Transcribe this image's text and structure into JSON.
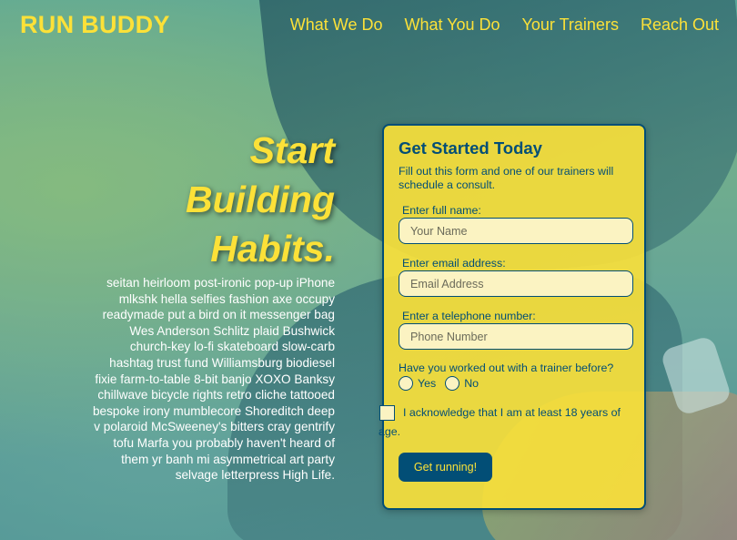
{
  "header": {
    "logo": "RUN BUDDY",
    "nav": [
      "What We Do",
      "What You Do",
      "Your Trainers",
      "Reach Out"
    ]
  },
  "intro": {
    "headline_1": "Start",
    "headline_2": "Building",
    "headline_3": "Habits.",
    "body": "seitan heirloom post-ironic pop-up iPhone mlkshk hella selfies fashion axe occupy readymade put a bird on it messenger bag Wes Anderson Schlitz plaid Bushwick church-key lo-fi skateboard slow-carb hashtag trust fund Williamsburg biodiesel fixie farm-to-table 8-bit banjo XOXO Banksy chillwave bicycle rights retro cliche tattooed bespoke irony mumblecore Shoreditch deep v polaroid McSweeney's bitters cray gentrify tofu Marfa you probably haven't heard of them yr banh mi asymmetrical art party selvage letterpress High Life."
  },
  "form": {
    "title": "Get Started Today",
    "subtitle": "Fill out this form and one of our trainers will schedule a consult.",
    "name_label": "Enter full name:",
    "name_placeholder": "Your Name",
    "email_label": "Enter email address:",
    "email_placeholder": "Email Address",
    "phone_label": "Enter a telephone number:",
    "phone_placeholder": "Phone Number",
    "question": "Have you worked out with a trainer before?",
    "yes": "Yes",
    "no": "No",
    "acknowledge": "I acknowledge that I am at least 18 years of age.",
    "submit": "Get running!"
  },
  "colors": {
    "accent": "#fce138",
    "primary": "#024e76"
  }
}
